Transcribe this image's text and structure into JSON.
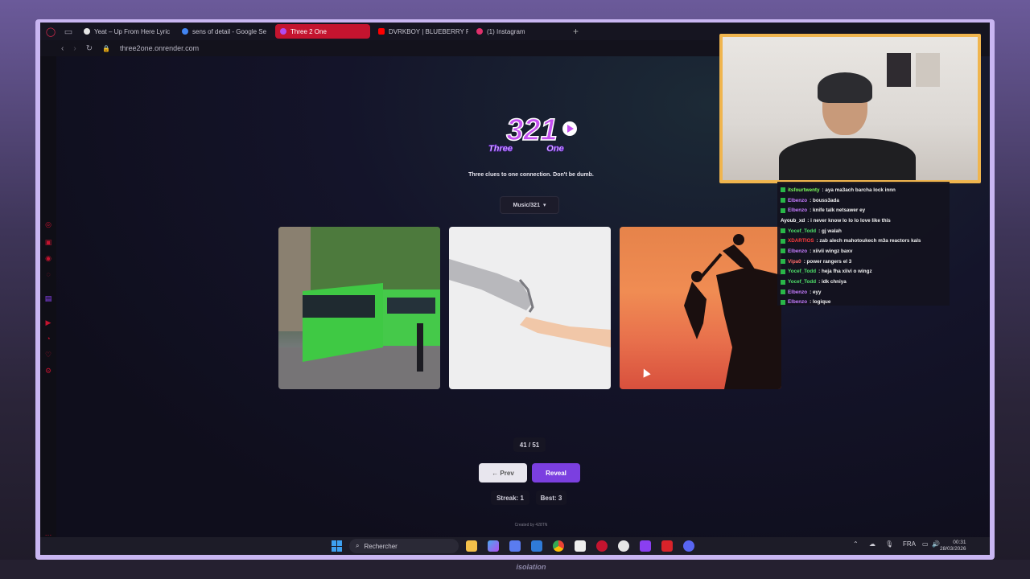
{
  "browser": {
    "tabs": [
      {
        "label": "Yeat – Up From Here Lyric",
        "favicon_color": "#e6e6e6"
      },
      {
        "label": "sens of detail - Google Se",
        "favicon_color": "#4285f4"
      },
      {
        "label": "Three 2 One",
        "favicon_color": "#b14cf0",
        "active": true
      },
      {
        "label": "DVRKBOY | BLUEBERRY F",
        "favicon_color": "#ff0000"
      },
      {
        "label": "(1) Instagram",
        "favicon_color": "#e1306c"
      }
    ],
    "new_tab_icon": "plus-icon",
    "url": "three2one.onrender.com"
  },
  "logo": {
    "number": "321",
    "left_text": "Three",
    "right_text": "One"
  },
  "game": {
    "tagline": "Three clues to one connection. Don't be dumb.",
    "category": "Music/321",
    "counter": "41 / 51",
    "prev_label": "← Prev",
    "reveal_label": "Reveal",
    "streak_label": "Streak: 1",
    "best_label": "Best: 3",
    "credits": "Created by 428TN",
    "accent": "#7b3fe0"
  },
  "taskbar": {
    "search_label": "Rechercher",
    "language": "FRA",
    "time": "00:31",
    "date": "28/03/2026"
  },
  "chat": [
    {
      "user": "itsfourtwenty",
      "color": "#7cff5a",
      "msg": "aya ma3ach barcha lock innn"
    },
    {
      "user": "Elbenzo",
      "color": "#c67cff",
      "msg": "bouss3ada"
    },
    {
      "user": "Elbenzo",
      "color": "#c67cff",
      "msg": "knife talk netsawer ey"
    },
    {
      "user": "Ayoub_xd",
      "color": "#ffffff",
      "msg": "i never know lo lo lo love like this"
    },
    {
      "user": "Yocef_Todd",
      "color": "#4fe06a",
      "msg": "gj walah"
    },
    {
      "user": "XDARTIOS",
      "color": "#ff3b3b",
      "msg": "zab alech mahotoukech m3a reactors kals"
    },
    {
      "user": "Elbenzo",
      "color": "#c67cff",
      "msg": "xiivii wingz baxv"
    },
    {
      "user": "Vipa0",
      "color": "#ff6b6b",
      "msg": "power rangers el 3"
    },
    {
      "user": "Yocef_Todd",
      "color": "#4fe06a",
      "msg": "heja fha xiivi o wingz"
    },
    {
      "user": "Yocef_Todd",
      "color": "#4fe06a",
      "msg": "idk chniya"
    },
    {
      "user": "Elbenzo",
      "color": "#c67cff",
      "msg": "eyy"
    },
    {
      "user": "Elbenzo",
      "color": "#c67cff",
      "msg": "logique"
    }
  ],
  "overlay": {
    "bottom_text": "isolation"
  }
}
